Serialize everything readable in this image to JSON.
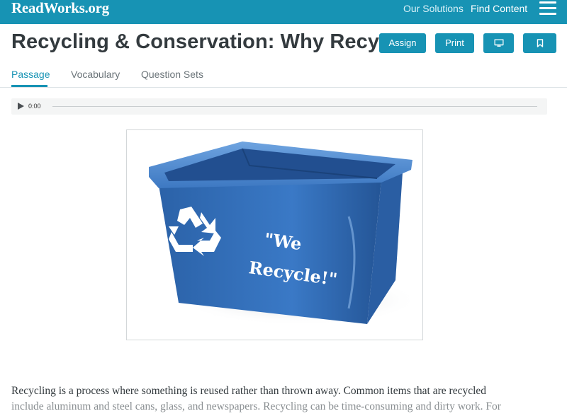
{
  "header": {
    "logo": "ReadWorks.org",
    "nav": [
      "Our Solutions",
      "Find Content"
    ],
    "menu_icon": "hamburger-menu-icon"
  },
  "article": {
    "title": "Recycling & Conservation: Why Recycle?",
    "actions": {
      "assign": "Assign",
      "print": "Print",
      "present_icon": "monitor-icon",
      "save_icon": "bookmark-icon"
    },
    "tabs": [
      "Passage",
      "Vocabulary",
      "Question Sets"
    ],
    "active_tab": "Passage"
  },
  "audio": {
    "time": "0:00",
    "progress": 0
  },
  "figure": {
    "image": "blue recycling bin",
    "bin_label": "\"We Recycle!\""
  },
  "passage": {
    "line1": "Recycling is a process where something is reused rather than thrown away. Common items that are recycled",
    "line2": "include aluminum and steel cans, glass, and newspapers. Recycling can be time-consuming and dirty work. For"
  },
  "colors": {
    "brand": "#1793b4",
    "bin_blue": "#2f6fb8"
  }
}
